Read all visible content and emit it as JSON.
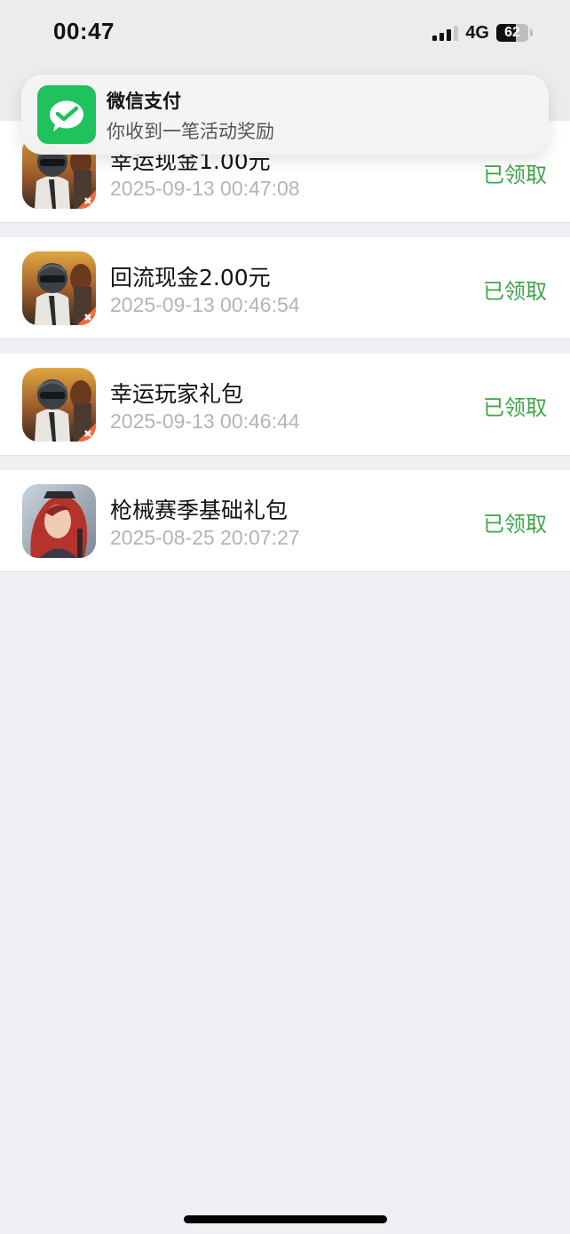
{
  "status_bar": {
    "time": "00:47",
    "network": "4G",
    "battery_level": "62",
    "signal_bars_active": 3
  },
  "notification": {
    "app_name": "微信支付",
    "message": "你收到一笔活动奖励",
    "icon": "wechat-pay-icon",
    "accent": "#1fc25d"
  },
  "records": [
    {
      "title": "幸运现金1.00元",
      "time": "2025-09-13 00:47:08",
      "status": "已领取",
      "icon": "game-icon-helmet"
    },
    {
      "title": "回流现金2.00元",
      "time": "2025-09-13 00:46:54",
      "status": "已领取",
      "icon": "game-icon-helmet"
    },
    {
      "title": "幸运玩家礼包",
      "time": "2025-09-13 00:46:44",
      "status": "已领取",
      "icon": "game-icon-helmet"
    },
    {
      "title": "枪械赛季基础礼包",
      "time": "2025-08-25 20:07:27",
      "status": "已领取",
      "icon": "game-icon-redhair"
    }
  ],
  "colors": {
    "status_green": "#3fa449",
    "timestamp_gray": "#b4b4b4",
    "page_background": "#efeff4"
  }
}
